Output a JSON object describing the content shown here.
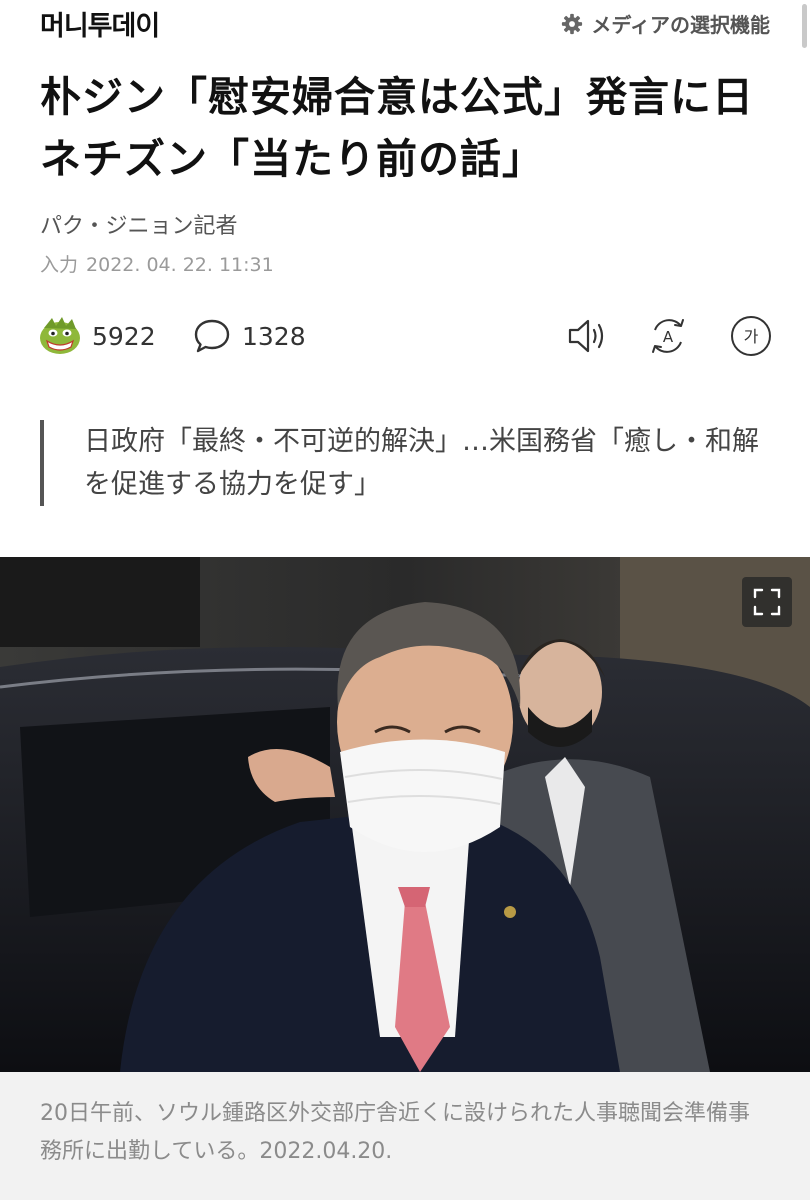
{
  "header": {
    "brand": "머니투데이",
    "media_choice_label": "メディアの選択機能"
  },
  "article": {
    "headline": "朴ジン「慰安婦合意は公式」発言に日ネチズン「当たり前の話」",
    "byline": "パク・ジニョン記者",
    "date_label": "入力",
    "date_value": "2022. 04. 22. 11:31",
    "reaction_count": "5922",
    "comment_count": "1328",
    "font_icon_label": "가",
    "translate_icon_label": "A",
    "subheadline": "日政府「最終・不可逆的解決」…米国務省「癒し・和解を促進する協力を促す」",
    "photo_caption": "20日午前、ソウル鍾路区外交部庁舎近くに設けられた人事聴聞会準備事務所に出勤している。2022.04.20."
  },
  "icons": {
    "settings": "gear-icon",
    "reaction": "reaction-emoji-icon",
    "comment": "speech-bubble-icon",
    "tts": "speaker-icon",
    "translate": "translate-icon",
    "font_size": "font-size-icon",
    "expand": "fullscreen-icon"
  },
  "colors": {
    "text_primary": "#111111",
    "text_secondary": "#555555",
    "text_muted": "#9a9a9a",
    "caption_background": "#f2f2f2",
    "reaction_icon_green": "#8fb83a"
  }
}
